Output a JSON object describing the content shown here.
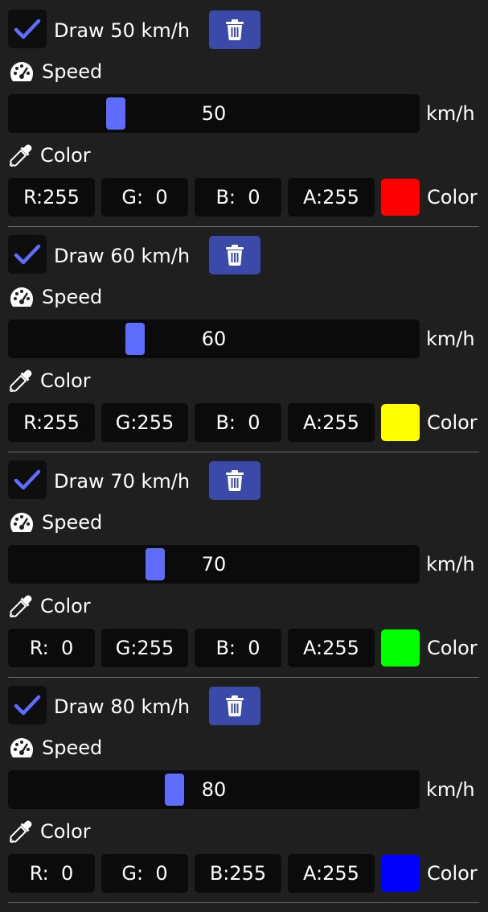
{
  "sections": [
    {
      "draw_label": "Draw 50 km/h",
      "checked": true,
      "speed_label": "Speed",
      "speed_value": "50",
      "speed_fraction": 0.25,
      "unit": "km/h",
      "color_label": "Color",
      "r": "R:255",
      "g": "G:  0",
      "b": "B:  0",
      "a": "A:255",
      "swatch_color": "#ff0000",
      "swatch_label": "Color"
    },
    {
      "draw_label": "Draw 60 km/h",
      "checked": true,
      "speed_label": "Speed",
      "speed_value": "60",
      "speed_fraction": 0.3,
      "unit": "km/h",
      "color_label": "Color",
      "r": "R:255",
      "g": "G:255",
      "b": "B:  0",
      "a": "A:255",
      "swatch_color": "#ffff00",
      "swatch_label": "Color"
    },
    {
      "draw_label": "Draw 70 km/h",
      "checked": true,
      "speed_label": "Speed",
      "speed_value": "70",
      "speed_fraction": 0.35,
      "unit": "km/h",
      "color_label": "Color",
      "r": "R:  0",
      "g": "G:255",
      "b": "B:  0",
      "a": "A:255",
      "swatch_color": "#00ff00",
      "swatch_label": "Color"
    },
    {
      "draw_label": "Draw 80 km/h",
      "checked": true,
      "speed_label": "Speed",
      "speed_value": "80",
      "speed_fraction": 0.4,
      "unit": "km/h",
      "color_label": "Color",
      "r": "R:  0",
      "g": "G:  0",
      "b": "B:255",
      "a": "A:255",
      "swatch_color": "#0000ff",
      "swatch_label": "Color"
    }
  ],
  "icons": {
    "checkbox": "checkmark-icon",
    "delete": "trash-icon",
    "speed": "speedometer-icon",
    "color": "eyedropper-icon"
  },
  "colors": {
    "accent": "#5f6dff",
    "button": "#3b4aa8",
    "background": "#1f1f1f",
    "field": "#0b0b0b"
  }
}
